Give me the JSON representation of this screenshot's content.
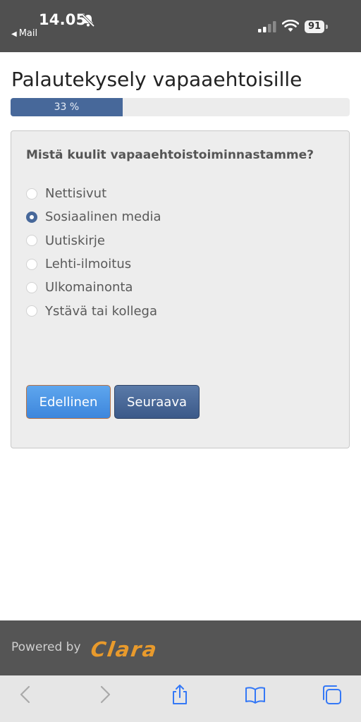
{
  "status_bar": {
    "time": "14.05",
    "back_app_label": "Mail",
    "battery_level": "91",
    "icons": [
      "bell-slash-icon",
      "signal-icon",
      "wifi-icon",
      "battery-icon"
    ]
  },
  "survey": {
    "title": "Palautekysely vapaaehtoisille",
    "progress_label": "33 %",
    "progress_fraction": 0.33,
    "question": "Mistä kuulit vapaaehtoistoiminnastamme?",
    "options": [
      {
        "label": "Nettisivut",
        "selected": false
      },
      {
        "label": "Sosiaalinen media",
        "selected": true
      },
      {
        "label": "Uutiskirje",
        "selected": false
      },
      {
        "label": "Lehti-ilmoitus",
        "selected": false
      },
      {
        "label": "Ulkomainonta",
        "selected": false
      },
      {
        "label": "Ystävä tai kollega",
        "selected": false
      }
    ],
    "prev_button": "Edellinen",
    "next_button": "Seuraava"
  },
  "footer": {
    "powered_by": "Powered by",
    "logo_text": "Clara"
  },
  "browser_toolbar": {
    "icons": [
      "back-icon",
      "forward-icon",
      "share-icon",
      "bookmarks-icon",
      "tabs-icon"
    ]
  },
  "colors": {
    "accent": "#47689a",
    "status_bar_bg": "#505050",
    "footer_bg": "#555555",
    "logo": "#e89a2c",
    "prev_button": "#4a94e4",
    "next_button": "#4a6a98"
  }
}
